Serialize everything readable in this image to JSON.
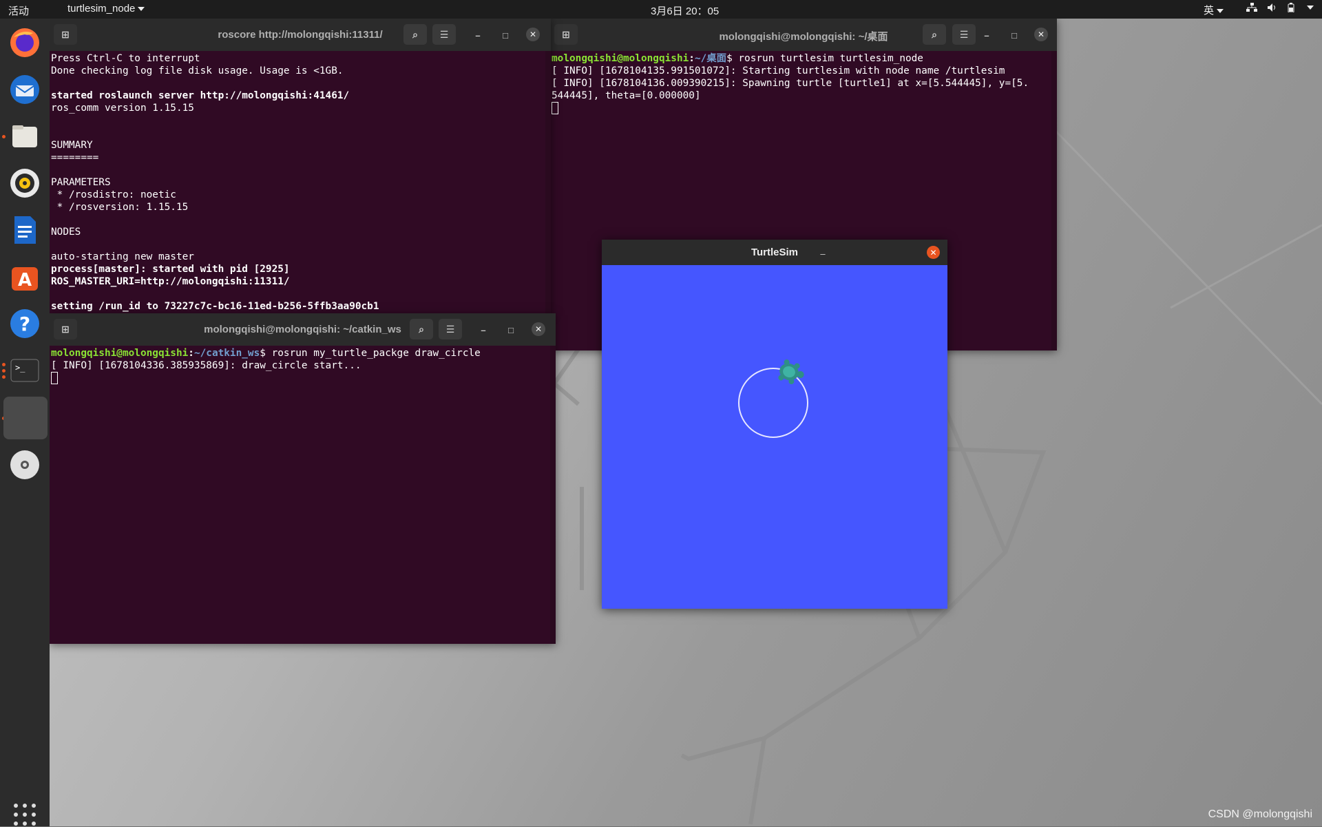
{
  "topbar": {
    "activities": "活动",
    "app_menu": "turtlesim_node",
    "clock": "3月6日  20：05",
    "input_method": "英"
  },
  "dock": {
    "items": [
      "firefox-icon",
      "thunderbird-icon",
      "files-icon",
      "rhythmbox-icon",
      "libreoffice-writer-icon",
      "ubuntu-software-icon",
      "help-icon",
      "terminal-icon",
      "turtlesim-app-icon",
      "dvd-icon"
    ],
    "show_apps": "show-applications-icon"
  },
  "roscore_window": {
    "title": "roscore http://molongqishi:11311/",
    "lines": [
      {
        "text": "Press Ctrl-C to interrupt",
        "bold": false
      },
      {
        "text": "Done checking log file disk usage. Usage is <1GB.",
        "bold": false
      },
      {
        "text": "",
        "bold": false
      },
      {
        "text": "started roslaunch server http://molongqishi:41461/",
        "bold": true
      },
      {
        "text": "ros_comm version 1.15.15",
        "bold": false
      },
      {
        "text": "",
        "bold": false
      },
      {
        "text": "",
        "bold": false
      },
      {
        "text": "SUMMARY",
        "bold": false
      },
      {
        "text": "========",
        "bold": false
      },
      {
        "text": "",
        "bold": false
      },
      {
        "text": "PARAMETERS",
        "bold": false
      },
      {
        "text": " * /rosdistro: noetic",
        "bold": false
      },
      {
        "text": " * /rosversion: 1.15.15",
        "bold": false
      },
      {
        "text": "",
        "bold": false
      },
      {
        "text": "NODES",
        "bold": false
      },
      {
        "text": "",
        "bold": false
      },
      {
        "text": "auto-starting new master",
        "bold": false
      },
      {
        "text": "process[master]: started with pid [2925]",
        "bold": true
      },
      {
        "text": "ROS_MASTER_URI=http://molongqishi:11311/",
        "bold": true
      },
      {
        "text": "",
        "bold": false
      },
      {
        "text": "setting /run_id to 73227c7c-bc16-11ed-b256-5ffb3aa90cb1",
        "bold": true
      }
    ]
  },
  "turtlesim_terminal": {
    "title": "molongqishi@molongqishi: ~/桌面",
    "prompt_user": "molongqishi@molongqishi",
    "prompt_path": "~/桌面",
    "command": "$ rosrun turtlesim turtlesim_node",
    "output": [
      "[ INFO] [1678104135.991501072]: Starting turtlesim with node name /turtlesim",
      "[ INFO] [1678104136.009390215]: Spawning turtle [turtle1] at x=[5.544445], y=[5.",
      "544445], theta=[0.000000]"
    ]
  },
  "catkin_terminal": {
    "title": "molongqishi@molongqishi: ~/catkin_ws",
    "prompt_user": "molongqishi@molongqishi",
    "prompt_path": "~/catkin_ws",
    "command": "$ rosrun my_turtle_packge draw_circle",
    "output": [
      "[ INFO] [1678104336.385935869]: draw_circle start..."
    ]
  },
  "turtlesim_window": {
    "title": "TurtleSim",
    "background_color": "#4556ff",
    "path_color": "#e6e6ff"
  },
  "watermark": "CSDN @molongqishi"
}
